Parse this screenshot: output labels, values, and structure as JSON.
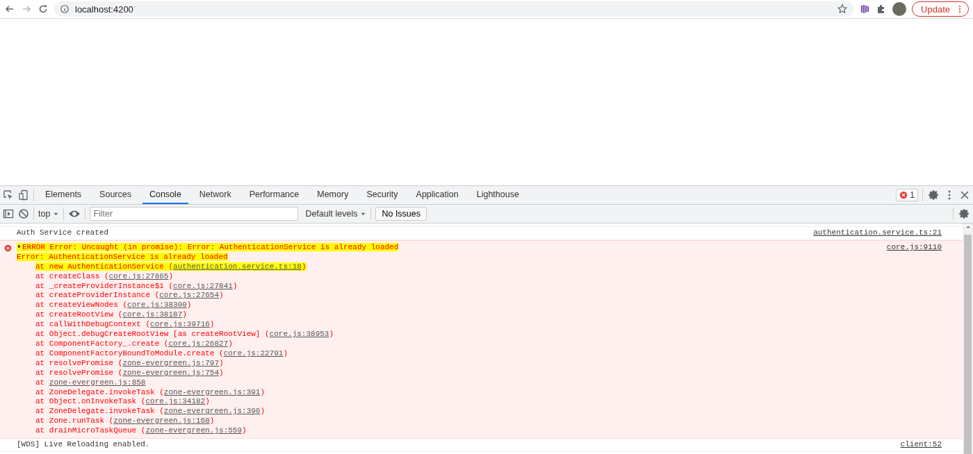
{
  "browser": {
    "address": "localhost:4200",
    "update_button": "Update"
  },
  "devtools": {
    "tabs": [
      {
        "label": "Elements",
        "selected": false
      },
      {
        "label": "Sources",
        "selected": false
      },
      {
        "label": "Console",
        "selected": true
      },
      {
        "label": "Network",
        "selected": false
      },
      {
        "label": "Performance",
        "selected": false
      },
      {
        "label": "Memory",
        "selected": false
      },
      {
        "label": "Security",
        "selected": false
      },
      {
        "label": "Application",
        "selected": false
      },
      {
        "label": "Lighthouse",
        "selected": false
      }
    ],
    "error_count": "1",
    "console_toolbar": {
      "context": "top",
      "filter_placeholder": "Filter",
      "levels": "Default levels",
      "issues": "No Issues"
    },
    "messages": [
      {
        "kind": "log",
        "text": "Auth Service created",
        "source": "authentication.service.ts:21"
      },
      {
        "kind": "error",
        "highlighted": true,
        "title": "ERROR Error: Uncaught (in promise): Error: AuthenticationService is already loaded",
        "source": "core.js:9110",
        "detail": "Error: AuthenticationService is already loaded",
        "detail_highlighted": true,
        "frames": [
          {
            "prefix": "at new AuthenticationService (",
            "link": "authentication.service.ts:18",
            "suffix": ")",
            "highlighted": true
          },
          {
            "prefix": "at createClass (",
            "link": "core.js:27865",
            "suffix": ")",
            "highlighted": false
          },
          {
            "prefix": "at _createProviderInstance$1 (",
            "link": "core.js:27841",
            "suffix": ")",
            "highlighted": false
          },
          {
            "prefix": "at createProviderInstance (",
            "link": "core.js:27654",
            "suffix": ")",
            "highlighted": false
          },
          {
            "prefix": "at createViewNodes (",
            "link": "core.js:38300",
            "suffix": ")",
            "highlighted": false
          },
          {
            "prefix": "at createRootView (",
            "link": "core.js:38187",
            "suffix": ")",
            "highlighted": false
          },
          {
            "prefix": "at callWithDebugContext (",
            "link": "core.js:39716",
            "suffix": ")",
            "highlighted": false
          },
          {
            "prefix": "at Object.debugCreateRootView [as createRootView] (",
            "link": "core.js:38953",
            "suffix": ")",
            "highlighted": false
          },
          {
            "prefix": "at ComponentFactory_.create (",
            "link": "core.js:26827",
            "suffix": ")",
            "highlighted": false
          },
          {
            "prefix": "at ComponentFactoryBoundToModule.create (",
            "link": "core.js:22791",
            "suffix": ")",
            "highlighted": false
          },
          {
            "prefix": "at resolvePromise (",
            "link": "zone-evergreen.js:797",
            "suffix": ")",
            "highlighted": false
          },
          {
            "prefix": "at resolvePromise (",
            "link": "zone-evergreen.js:754",
            "suffix": ")",
            "highlighted": false
          },
          {
            "prefix": "at ",
            "link": "zone-evergreen.js:858",
            "highlighted": false
          },
          {
            "prefix": "at ZoneDelegate.invokeTask (",
            "link": "zone-evergreen.js:391",
            "suffix": ")",
            "highlighted": false
          },
          {
            "prefix": "at Object.onInvokeTask (",
            "link": "core.js:34182",
            "suffix": ")",
            "highlighted": false
          },
          {
            "prefix": "at ZoneDelegate.invokeTask (",
            "link": "zone-evergreen.js:390",
            "suffix": ")",
            "highlighted": false
          },
          {
            "prefix": "at Zone.runTask (",
            "link": "zone-evergreen.js:168",
            "suffix": ")",
            "highlighted": false
          },
          {
            "prefix": "at drainMicroTaskQueue (",
            "link": "zone-evergreen.js:559",
            "suffix": ")",
            "highlighted": false
          }
        ]
      },
      {
        "kind": "log",
        "text": "[WDS] Live Reloading enabled.",
        "source": "client:52"
      }
    ]
  }
}
